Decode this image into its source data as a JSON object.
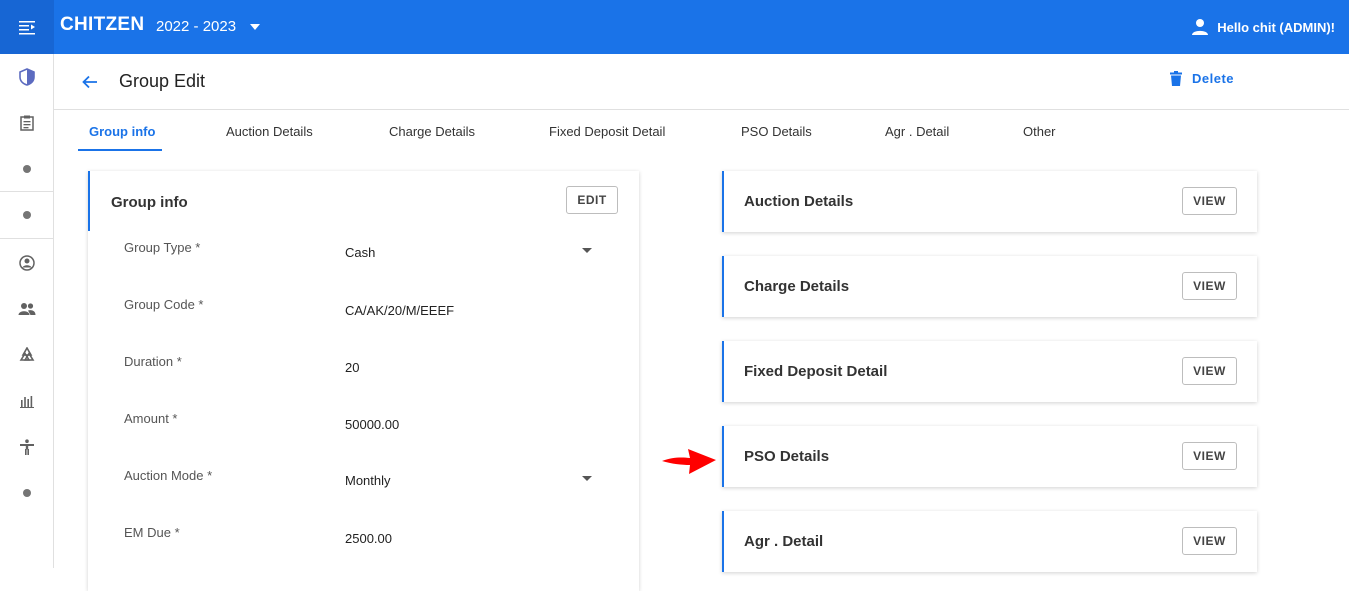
{
  "topbar": {
    "brand": "CHITZEN",
    "year": "2022 - 2023",
    "user": "Hello chit (ADMIN)!"
  },
  "sidebar": {
    "items": [
      {
        "icon": "shield-icon"
      },
      {
        "icon": "clipboard-icon"
      },
      {
        "icon": "dot-icon"
      },
      {
        "icon": "dot-icon"
      },
      {
        "icon": "account-circle-icon"
      },
      {
        "icon": "group-icon"
      },
      {
        "icon": "recycle-icon"
      },
      {
        "icon": "bar-chart-icon"
      },
      {
        "icon": "person-accessibility-icon"
      },
      {
        "icon": "dot-icon"
      }
    ]
  },
  "header": {
    "title": "Group Edit",
    "delete_label": "Delete"
  },
  "tabs": [
    {
      "label": "Group info",
      "active": true
    },
    {
      "label": "Auction Details"
    },
    {
      "label": "Charge Details"
    },
    {
      "label": "Fixed Deposit Detail"
    },
    {
      "label": "PSO Details"
    },
    {
      "label": "Agr . Detail"
    },
    {
      "label": "Other"
    }
  ],
  "group_info": {
    "title": "Group info",
    "edit_label": "EDIT",
    "fields": [
      {
        "label": "Group Type *",
        "value": "Cash",
        "dropdown": true
      },
      {
        "label": "Group Code *",
        "value": "CA/AK/20/M/EEEF"
      },
      {
        "label": "Duration *",
        "value": "20"
      },
      {
        "label": "Amount *",
        "value": "50000.00"
      },
      {
        "label": "Auction Mode *",
        "value": "Monthly",
        "dropdown": true
      },
      {
        "label": "EM Due *",
        "value": "2500.00"
      }
    ]
  },
  "detail_cards": [
    {
      "title": "Auction Details",
      "button": "VIEW"
    },
    {
      "title": "Charge Details",
      "button": "VIEW"
    },
    {
      "title": "Fixed Deposit Detail",
      "button": "VIEW"
    },
    {
      "title": "PSO Details",
      "button": "VIEW"
    },
    {
      "title": "Agr . Detail",
      "button": "VIEW"
    }
  ],
  "colors": {
    "primary": "#1a73e8",
    "annotation_arrow": "#ff0000"
  }
}
